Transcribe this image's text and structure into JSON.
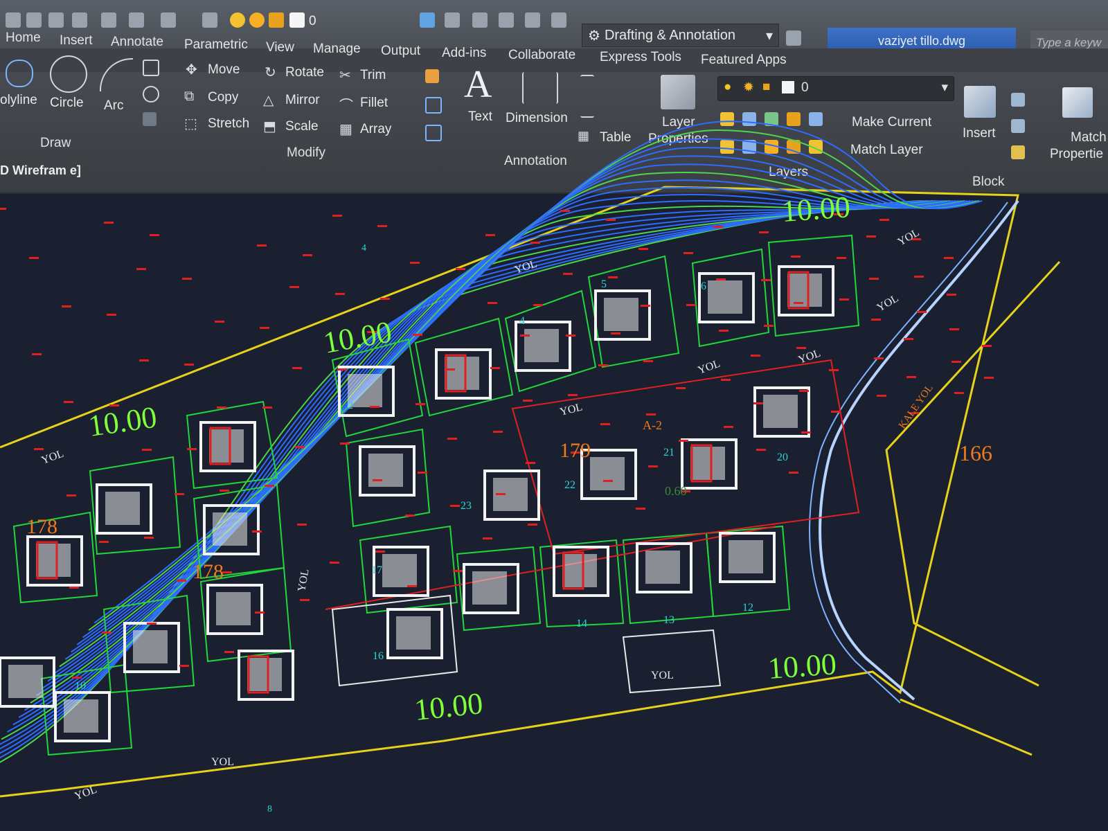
{
  "quick_access": {
    "layer_value": "0",
    "workspace": "Drafting & Annotation",
    "file_title": "vaziyet tillo.dwg",
    "search_placeholder": "Type a keyw"
  },
  "tabs": [
    "Home",
    "Insert",
    "Annotate",
    "Parametric",
    "View",
    "Manage",
    "Output",
    "Add-ins",
    "Collaborate",
    "Express Tools",
    "Featured Apps"
  ],
  "ribbon": {
    "draw": {
      "polyline": "olyline",
      "circle": "Circle",
      "arc": "Arc",
      "title": "Draw"
    },
    "modify": {
      "move": "Move",
      "rotate": "Rotate",
      "trim": "Trim",
      "copy": "Copy",
      "mirror": "Mirror",
      "fillet": "Fillet",
      "stretch": "Stretch",
      "scale": "Scale",
      "array": "Array",
      "title": "Modify"
    },
    "annotation": {
      "text": "Text",
      "dimension": "Dimension",
      "table": "Table",
      "title": "Annotation"
    },
    "layers": {
      "layer_properties_1": "Layer",
      "layer_properties_2": "Properties",
      "current_layer": "0",
      "make_current": "Make Current",
      "match_layer": "Match Layer",
      "title": "Layers"
    },
    "block": {
      "insert": "Insert",
      "title": "Block"
    },
    "properties": {
      "match_1": "Match",
      "match_2": "Propertie"
    }
  },
  "viewport": {
    "label": "D Wirefram e]"
  },
  "drawing": {
    "setback_labels": [
      "10.00",
      "10.00",
      "10.00",
      "10.00",
      "10.00"
    ],
    "block_numbers": [
      "178",
      "178",
      "179",
      "166"
    ],
    "road_labels": [
      "YOL",
      "YOL",
      "YOL",
      "YOL",
      "YOL",
      "YOL",
      "YOL",
      "YOL",
      "YOL",
      "YOL",
      "YOL",
      "KALE YOL"
    ],
    "parcel_numbers": [
      "4",
      "5",
      "6",
      "2",
      "4",
      "20",
      "21",
      "22",
      "23",
      "17",
      "16",
      "14",
      "13",
      "12",
      "10",
      "8",
      "A-2",
      "0.60"
    ],
    "colors": {
      "boundary": "#e6d21a",
      "contour": "#2e6bff",
      "parcel": "#22d63a",
      "plot": "#e02020",
      "building": "#f2f2f2",
      "text_orange": "#f07a1a",
      "text_cyan": "#29d7d7"
    }
  }
}
